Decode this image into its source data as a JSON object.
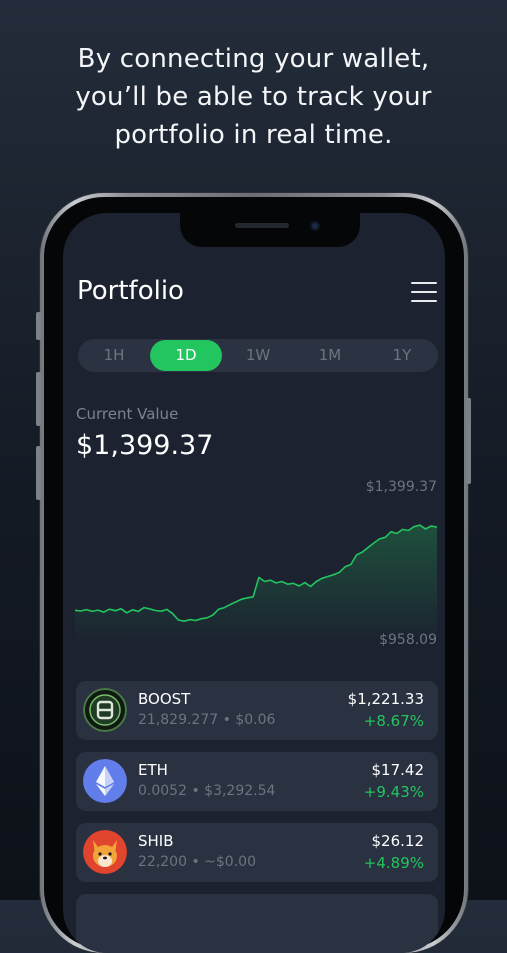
{
  "headline": {
    "line1": "By connecting your wallet,",
    "line2": "you’ll be able to track your",
    "line3": "portfolio in real time."
  },
  "app": {
    "title": "Portfolio",
    "tabs": [
      {
        "label": "1H",
        "active": false
      },
      {
        "label": "1D",
        "active": true
      },
      {
        "label": "1W",
        "active": false
      },
      {
        "label": "1M",
        "active": false
      },
      {
        "label": "1Y",
        "active": false
      }
    ],
    "current_value_label": "Current Value",
    "current_value": "$1,399.37",
    "chart_max_label": "$1,399.37",
    "chart_min_label": "$958.09",
    "accent_color": "#22c55e",
    "assets": [
      {
        "name": "BOOST",
        "amount": "21,829.277",
        "price": "$0.06",
        "value": "$1,221.33",
        "change": "+8.67%",
        "icon": "boost-coin-icon"
      },
      {
        "name": "ETH",
        "amount": "0.0052",
        "price": "$3,292.54",
        "value": "$17.42",
        "change": "+9.43%",
        "icon": "ethereum-icon"
      },
      {
        "name": "SHIB",
        "amount": "22,200",
        "price": "~$0.00",
        "value": "$26.12",
        "change": "+4.89%",
        "icon": "shiba-inu-icon"
      }
    ]
  },
  "chart_data": {
    "type": "line",
    "title": "",
    "xlabel": "",
    "ylabel": "",
    "ylim": [
      958.09,
      1399.37
    ],
    "series": [
      {
        "name": "",
        "values": [
          1023,
          1020,
          1026,
          1018,
          1024,
          1015,
          1028,
          1021,
          1030,
          1012,
          1025,
          1018,
          1035,
          1029,
          1022,
          1019,
          1027,
          1008,
          980,
          975,
          982,
          978,
          986,
          990,
          1002,
          1028,
          1035,
          1048,
          1060,
          1072,
          1078,
          1082,
          1168,
          1150,
          1156,
          1144,
          1150,
          1138,
          1142,
          1130,
          1145,
          1128,
          1150,
          1164,
          1172,
          1180,
          1190,
          1215,
          1225,
          1268,
          1280,
          1300,
          1320,
          1338,
          1345,
          1370,
          1362,
          1380,
          1375,
          1392,
          1399,
          1382,
          1395,
          1390
        ]
      }
    ]
  }
}
